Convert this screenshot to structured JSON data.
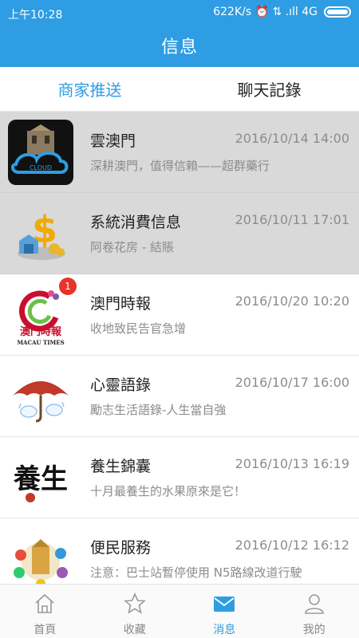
{
  "status_bar": {
    "time": "上午10:28",
    "indicators": "622K/s ⏰ ⇅ .ıll 4G"
  },
  "header": {
    "title": "信息"
  },
  "tabs": [
    {
      "label": "商家推送",
      "active": true
    },
    {
      "label": "聊天記錄",
      "active": false
    }
  ],
  "messages": [
    {
      "name": "雲澳門",
      "date": "2016/10/14 14:00",
      "preview": "深耕澳門，值得信賴——超群藥行",
      "selected": true,
      "avatar_icon": "cloud-macau-logo",
      "avatar_text": "CLOUD"
    },
    {
      "name": "系統消費信息",
      "date": "2016/10/11 17:01",
      "preview": "阿卷花房 - 結賬",
      "selected": true,
      "avatar_icon": "dollar-sign-icon"
    },
    {
      "name": "澳門時報",
      "date": "2016/10/20 10:20",
      "preview": "收地致民告官急增",
      "badge": "1",
      "avatar_icon": "macau-times-logo",
      "avatar_text": "澳門時報",
      "avatar_subtext": "MACAU TIMES"
    },
    {
      "name": "心靈語錄",
      "date": "2016/10/17 16:00",
      "preview": "勵志生活語錄-人生當自強",
      "avatar_icon": "umbrella-icon"
    },
    {
      "name": "養生錦囊",
      "date": "2016/10/13 16:19",
      "preview": "十月最養生的水果原來是它！",
      "avatar_icon": "calligraphy-icon",
      "avatar_text": "養生"
    },
    {
      "name": "便民服務",
      "date": "2016/10/12 16:12",
      "preview": "注意：巴士站暫停使用 N5路線改道行駛",
      "avatar_icon": "city-services-icon"
    }
  ],
  "bottom_nav": [
    {
      "label": "首頁",
      "icon": "home-icon",
      "active": false
    },
    {
      "label": "收藏",
      "icon": "star-icon",
      "active": false
    },
    {
      "label": "消息",
      "icon": "mail-icon",
      "active": true
    },
    {
      "label": "我的",
      "icon": "person-icon",
      "active": false
    }
  ],
  "colors": {
    "accent": "#2e9de3",
    "selected_row": "#d9d9d9",
    "badge": "#e8332a"
  }
}
